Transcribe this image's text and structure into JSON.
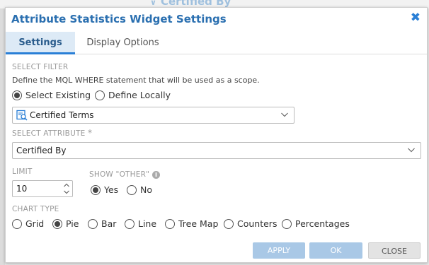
{
  "background": {
    "title": "Certified By"
  },
  "dialog": {
    "title": "Attribute Statistics Widget Settings",
    "close_glyph": "✖",
    "close_icon": "close-icon"
  },
  "tabs": [
    {
      "label": "Settings",
      "active": true
    },
    {
      "label": "Display Options",
      "active": false
    }
  ],
  "select_filter": {
    "section_label": "SELECT FILTER",
    "description": "Define the MQL WHERE statement that will be used as a scope.",
    "options": [
      {
        "label": "Select Existing",
        "selected": true
      },
      {
        "label": "Define Locally",
        "selected": false
      }
    ],
    "dropdown_value": "Certified Terms",
    "dropdown_icon": "filter-search-icon"
  },
  "select_attribute": {
    "section_label": "SELECT ATTRIBUTE",
    "required_mark": "*",
    "dropdown_value": "Certified By"
  },
  "limit": {
    "section_label": "LIMIT",
    "value": "10"
  },
  "show_other": {
    "section_label": "SHOW \"OTHER\"",
    "options": [
      {
        "label": "Yes",
        "selected": true
      },
      {
        "label": "No",
        "selected": false
      }
    ]
  },
  "chart_type": {
    "section_label": "CHART TYPE",
    "options": [
      {
        "label": "Grid",
        "selected": false
      },
      {
        "label": "Pie",
        "selected": true
      },
      {
        "label": "Bar",
        "selected": false
      },
      {
        "label": "Line",
        "selected": false
      },
      {
        "label": "Tree Map",
        "selected": false
      },
      {
        "label": "Counters",
        "selected": false
      },
      {
        "label": "Percentages",
        "selected": false
      }
    ]
  },
  "buttons": {
    "apply": "APPLY",
    "ok": "OK",
    "close": "CLOSE"
  },
  "colors": {
    "title": "#2a6fb0",
    "accent": "#2a7fd6",
    "tab_active_bg": "#ddeaf6",
    "primary_button_disabled": "#a9c8e6"
  }
}
